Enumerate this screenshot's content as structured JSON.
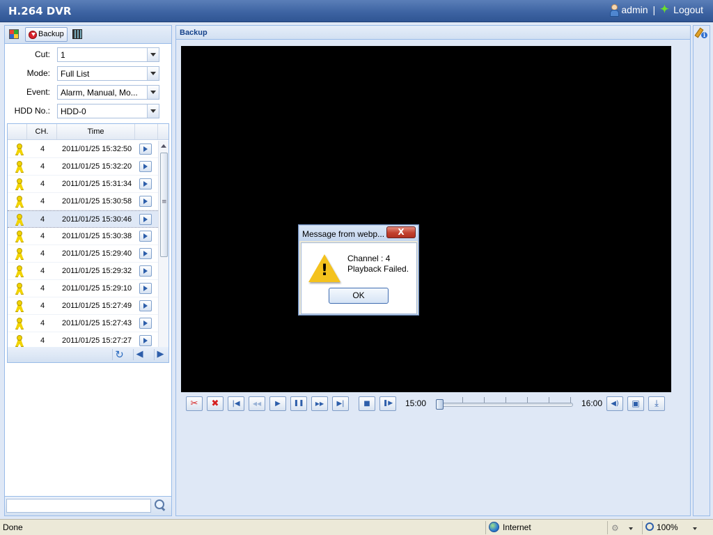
{
  "header": {
    "app_title": "H.264 DVR",
    "user": "admin",
    "separator": "|",
    "logout": "Logout"
  },
  "left_panel": {
    "tabs": {
      "backup_label": "Backup"
    },
    "form": {
      "cut_label": "Cut:",
      "cut_value": "1",
      "mode_label": "Mode:",
      "mode_value": "Full List",
      "event_label": "Event:",
      "event_value": "Alarm, Manual, Mo...",
      "hdd_label": "HDD No.:",
      "hdd_value": "HDD-0"
    },
    "table": {
      "columns": [
        "",
        "CH.",
        "Time",
        ""
      ],
      "rows": [
        {
          "ch": "4",
          "time": "2011/01/25 15:32:50"
        },
        {
          "ch": "4",
          "time": "2011/01/25 15:32:20"
        },
        {
          "ch": "4",
          "time": "2011/01/25 15:31:34"
        },
        {
          "ch": "4",
          "time": "2011/01/25 15:30:58"
        },
        {
          "ch": "4",
          "time": "2011/01/25 15:30:46"
        },
        {
          "ch": "4",
          "time": "2011/01/25 15:30:38"
        },
        {
          "ch": "4",
          "time": "2011/01/25 15:29:40"
        },
        {
          "ch": "4",
          "time": "2011/01/25 15:29:32"
        },
        {
          "ch": "4",
          "time": "2011/01/25 15:29:10"
        },
        {
          "ch": "4",
          "time": "2011/01/25 15:27:49"
        },
        {
          "ch": "4",
          "time": "2011/01/25 15:27:43"
        },
        {
          "ch": "4",
          "time": "2011/01/25 15:27:27"
        }
      ],
      "selected_row_index": 4
    },
    "search": {
      "value": ""
    }
  },
  "main_panel": {
    "title": "Backup",
    "controls": {
      "time_start": "15:00",
      "time_end": "16:00",
      "playback_position": 0.0
    }
  },
  "dialog": {
    "title": "Message from webp...",
    "close_label": "X",
    "message_line1": "Channel : 4",
    "message_line2": "Playback Failed.",
    "ok_label": "OK"
  },
  "status_bar": {
    "status": "Done",
    "zone": "Internet",
    "zoom": "100%"
  },
  "colors": {
    "header_blue": "#3e64a3",
    "panel_bg": "#dfe8f6",
    "panel_border": "#99bbe8",
    "video_bg": "#000000",
    "warning_yellow": "#f4c21d"
  }
}
